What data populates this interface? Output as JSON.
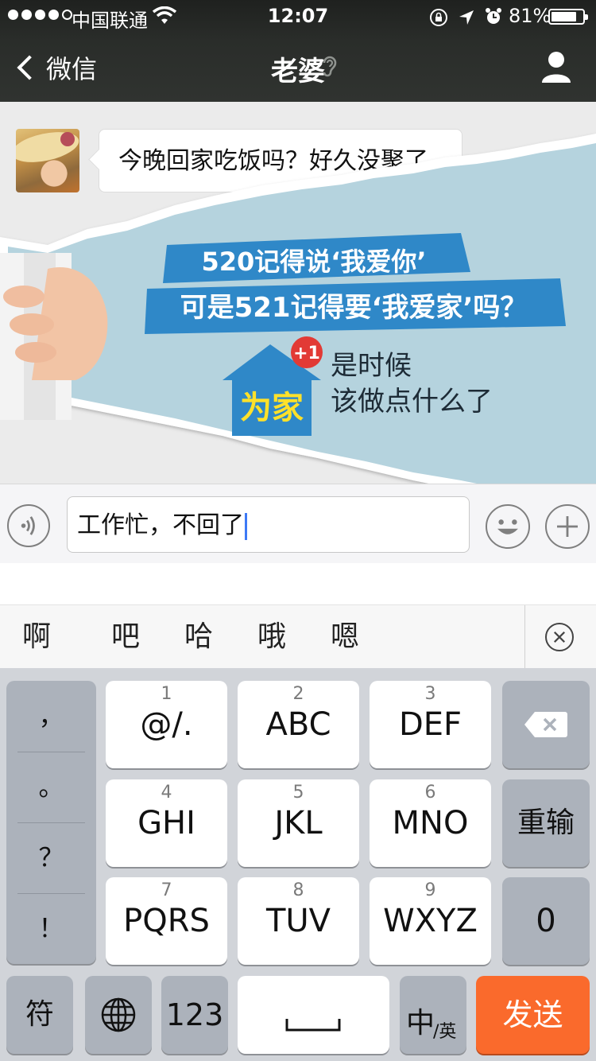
{
  "status_bar": {
    "carrier": "中国联通",
    "time": "12:07",
    "battery": "81%",
    "battery_level": 0.81
  },
  "nav": {
    "back_label": "微信",
    "title": "老婆"
  },
  "chat": {
    "message": "今晚回家吃饭吗？好久没聚了"
  },
  "ad": {
    "line1": "520记得说‘我爱你’",
    "line2": "可是521记得要‘我爱家’吗？",
    "badge": "+1",
    "house_text": "为家",
    "tagline1": "是时候",
    "tagline2": "该做点什么了"
  },
  "input": {
    "text": "工作忙，不回了"
  },
  "candidates": [
    "啊",
    "吧",
    "哈",
    "哦",
    "嗯"
  ],
  "keyboard": {
    "punctuation": [
      "，",
      "。",
      "？",
      "！"
    ],
    "rows": [
      [
        {
          "num": "1",
          "label": "@/."
        },
        {
          "num": "2",
          "label": "ABC"
        },
        {
          "num": "3",
          "label": "DEF"
        }
      ],
      [
        {
          "num": "4",
          "label": "GHI"
        },
        {
          "num": "5",
          "label": "JKL"
        },
        {
          "num": "6",
          "label": "MNO"
        }
      ],
      [
        {
          "num": "7",
          "label": "PQRS"
        },
        {
          "num": "8",
          "label": "TUV"
        },
        {
          "num": "9",
          "label": "WXYZ"
        }
      ]
    ],
    "retype": "重输",
    "zero": "0",
    "symbols": "符",
    "numbers": "123",
    "lang_main": "中",
    "lang_sub": "/英",
    "send": "发送"
  }
}
